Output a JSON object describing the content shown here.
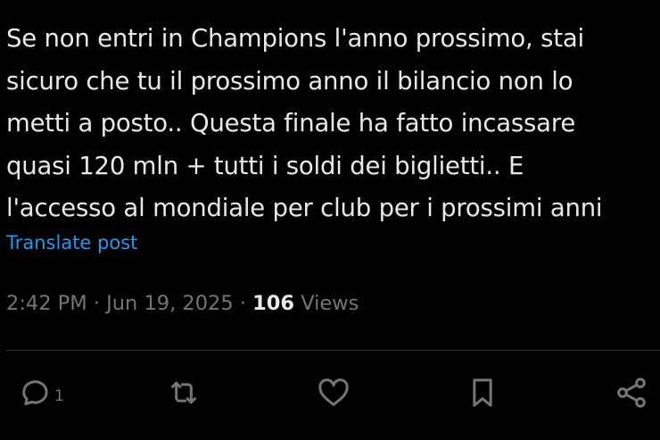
{
  "post": {
    "text_lines": [
      "Se non entri in Champions l'anno prossimo, stai",
      "sicuro che tu il prossimo anno il bilancio non lo",
      "metti a posto..  Questa finale ha fatto incassare",
      "quasi 120 mln + tutti i soldi dei biglietti.. E",
      "l'accesso al mondiale per club per i prossimi anni"
    ],
    "translate_label": "Translate post",
    "time": "2:42 PM",
    "separator": "·",
    "date": "Jun 19, 2025",
    "views_count": "106",
    "views_label": "Views"
  },
  "actions": {
    "reply": {
      "icon": "reply-icon",
      "count": "1"
    },
    "repost": {
      "icon": "repost-icon"
    },
    "like": {
      "icon": "heart-icon"
    },
    "bookmark": {
      "icon": "bookmark-icon"
    },
    "share": {
      "icon": "share-icon"
    }
  },
  "colors": {
    "background": "#000000",
    "text": "#e7e9ea",
    "muted": "#71767b",
    "link": "#1d9bf0",
    "divider": "#2f3336"
  }
}
